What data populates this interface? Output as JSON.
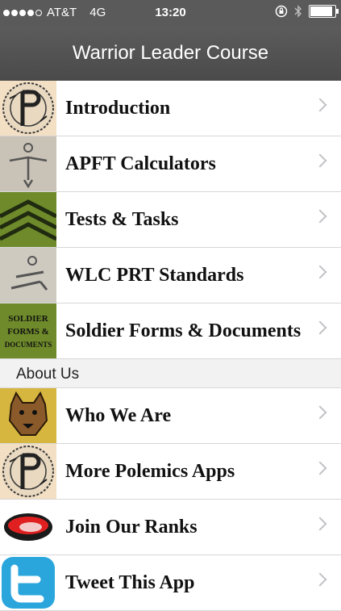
{
  "status_bar": {
    "carrier": "AT&T",
    "network": "4G",
    "time": "13:20",
    "signal_bars": 4,
    "signal_max": 5
  },
  "navbar": {
    "title": "Warrior Leader Course"
  },
  "list": {
    "items": [
      {
        "label": "Introduction",
        "icon": "polemics-logo-icon"
      },
      {
        "label": "APFT Calculators",
        "icon": "soldier-figure-icon"
      },
      {
        "label": "Tests & Tasks",
        "icon": "sergeant-chevron-icon"
      },
      {
        "label": "WLC PRT Standards",
        "icon": "sit-up-figure-icon"
      },
      {
        "label": "Soldier Forms & Documents",
        "icon": "forms-documents-icon",
        "icon_text": [
          "SOLDIER",
          "FORMS &",
          "DOCUMENTS"
        ]
      }
    ],
    "section_header": "About Us",
    "about_items": [
      {
        "label": "Who We Are",
        "icon": "bear-icon"
      },
      {
        "label": "More Polemics Apps",
        "icon": "polemics-logo-icon"
      },
      {
        "label": "Join Our Ranks",
        "icon": "red-mouth-icon"
      },
      {
        "label": "Tweet This App",
        "icon": "twitter-bird-icon"
      }
    ]
  },
  "colors": {
    "nav_bg": "#555555",
    "section_bg": "#f2f2f2",
    "chevron": "#c2c2c6",
    "twitter_blue": "#2aa6dd"
  }
}
